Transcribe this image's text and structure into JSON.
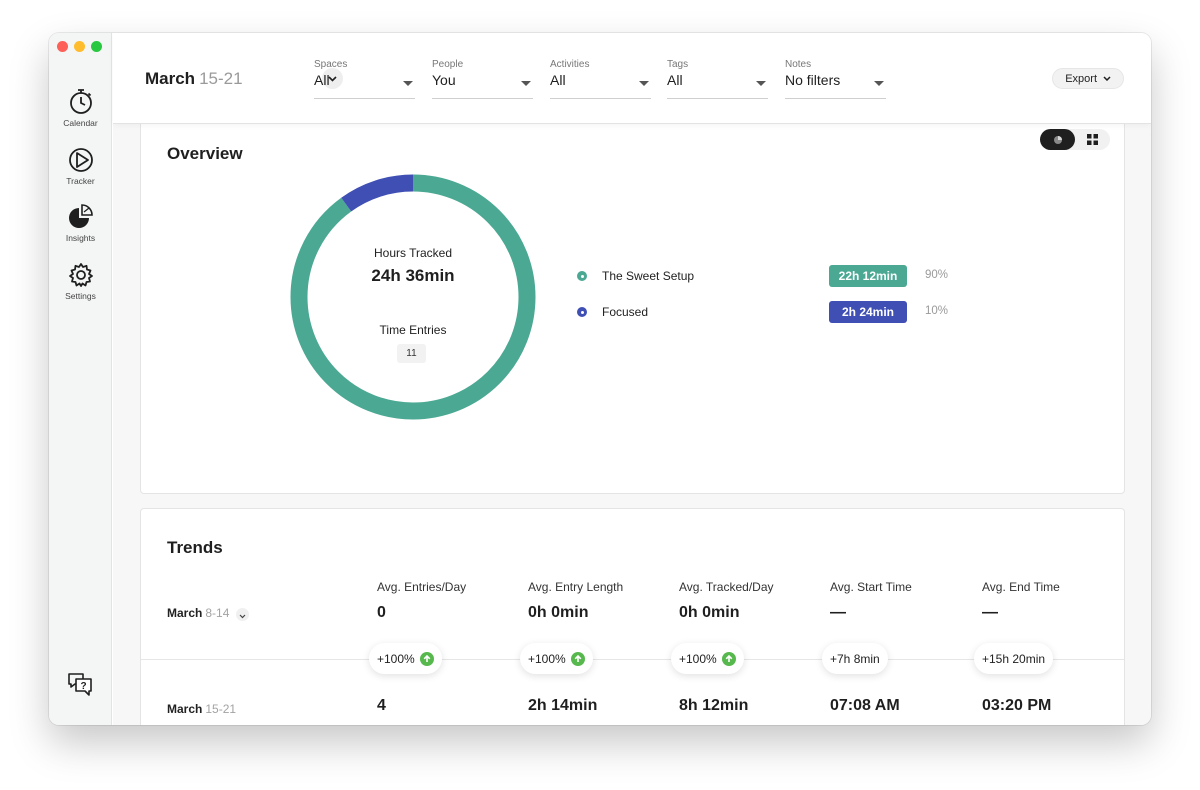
{
  "header": {
    "month": "March",
    "range": "15-21",
    "filters": [
      {
        "label": "Spaces",
        "value": "All"
      },
      {
        "label": "People",
        "value": "You"
      },
      {
        "label": "Activities",
        "value": "All"
      },
      {
        "label": "Tags",
        "value": "All"
      },
      {
        "label": "Notes",
        "value": "No filters"
      }
    ],
    "export_label": "Export"
  },
  "sidebar": {
    "items": [
      {
        "label": "Calendar",
        "icon": "stopwatch-icon"
      },
      {
        "label": "Tracker",
        "icon": "play-icon"
      },
      {
        "label": "Insights",
        "icon": "pie-chart-icon"
      },
      {
        "label": "Settings",
        "icon": "gear-icon"
      }
    ],
    "help_icon": "help-chat-icon"
  },
  "overview": {
    "title": "Overview",
    "hours_label": "Hours Tracked",
    "hours_value": "24h 36min",
    "entries_label": "Time Entries",
    "entries_count": "11",
    "donut_segments": [
      {
        "name": "The Sweet Setup",
        "fraction": 0.9,
        "color": "#4aa893"
      },
      {
        "name": "Focused",
        "fraction": 0.1,
        "color": "#3f4fb3"
      }
    ],
    "legend": [
      {
        "name": "The Sweet Setup",
        "time": "22h 12min",
        "pct": "90%",
        "color": "#4aa893"
      },
      {
        "name": "Focused",
        "time": "2h 24min",
        "pct": "10%",
        "color": "#3f4fb3"
      }
    ]
  },
  "trends": {
    "title": "Trends",
    "columns": [
      "Avg. Entries/Day",
      "Avg. Entry Length",
      "Avg. Tracked/Day",
      "Avg. Start Time",
      "Avg. End Time"
    ],
    "prev_week": {
      "month": "March",
      "range": "8-14",
      "values": [
        "0",
        "0h 0min",
        "0h 0min",
        "—",
        "—"
      ]
    },
    "changes": [
      "+100%",
      "+100%",
      "+100%",
      "+7h 8min",
      "+15h 20min"
    ],
    "curr_week": {
      "month": "March",
      "range": "15-21",
      "values": [
        "4",
        "2h 14min",
        "8h 12min",
        "07:08 AM",
        "03:20 PM"
      ]
    }
  }
}
